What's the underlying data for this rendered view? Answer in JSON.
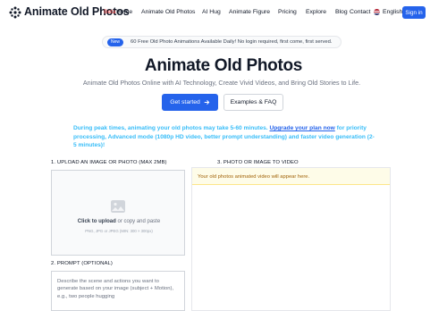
{
  "header": {
    "logo_text": "Animate Old Photos",
    "beta": "Beta",
    "nav": [
      {
        "label": "Home"
      },
      {
        "label": "Animate Old Photos"
      },
      {
        "label": "AI Hug"
      },
      {
        "label": "Animate Figure"
      },
      {
        "label": "Pricing"
      },
      {
        "label": "Explore"
      },
      {
        "label": "Blog"
      },
      {
        "label": "Contact"
      }
    ],
    "language": "English",
    "signin": "Sign in"
  },
  "announcement": {
    "badge": "New",
    "text": "60 Free Old Photo Animations Available Daily! No login required, first come, first served."
  },
  "hero": {
    "title": "Animate Old Photos",
    "subtitle": "Animate Old Photos Online with AI Technology, Create Vivid Videos, and Bring Old Stories to Life.",
    "primary_button": "Get started",
    "secondary_button": "Examples & FAQ"
  },
  "notice": {
    "before": "During peak times, animating your old photos may take 5-60 minutes. ",
    "link": "Upgrade your plan now",
    "after": " for priority processing, Advanced mode (1080p HD video, better prompt understanding) and faster video generation (2-5 minutes)!"
  },
  "upload": {
    "label": "1. UPLOAD AN IMAGE OR PHOTO (MAX 2MB)",
    "click": "Click to upload",
    "or_drag": " or copy and paste",
    "hint": "PNG, JPG or JPEG (MIN: 300 × 300px)"
  },
  "preview": {
    "label": "3. PHOTO OR IMAGE TO VIDEO",
    "placeholder": "Your old photos animated video will appear here."
  },
  "prompt": {
    "label": "2. PROMPT (OPTIONAL)",
    "placeholder": "Describe the scene and actions you want to generate based on your image (subject + Motion), e.g., two people hugging"
  },
  "colors": {
    "primary": "#2563eb",
    "notice": "#38bdf8",
    "beta": "#ef4444"
  }
}
